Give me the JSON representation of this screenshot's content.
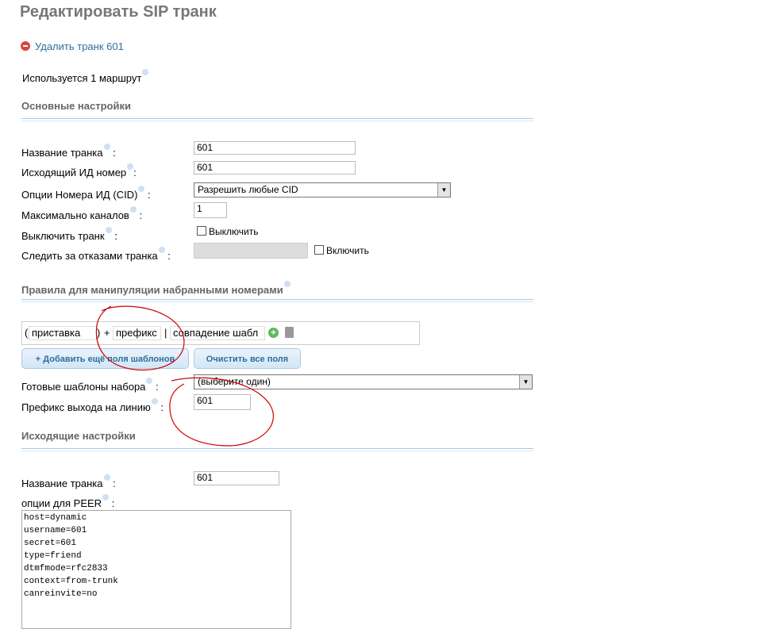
{
  "title": "Редактировать SIP транк",
  "delete_link": "Удалить транк 601",
  "used_routes": "Используется 1 маршрут",
  "sections": {
    "general": "Основные настройки",
    "dial_rules": "Правила для манипуляции набранными номерами",
    "outgoing": "Исходящие настройки"
  },
  "general": {
    "trunk_name_label": "Название транка",
    "trunk_name": "601",
    "outbound_cid_label": "Исходящий ИД номер",
    "outbound_cid": "601",
    "cid_options_label": "Опции Номера ИД (CID)",
    "cid_options": "Разрешить любые CID",
    "max_channels_label": "Максимально каналов",
    "max_channels": "1",
    "disable_label": "Выключить транк",
    "disable_checkbox": "Выключить",
    "monitor_label": "Следить за отказами транка",
    "monitor_checkbox": "Включить"
  },
  "dial_rules": {
    "prepend": "приставка",
    "plus": "+",
    "prefix": "префикс",
    "pipe": "|",
    "match": "совпадение шабл",
    "open_paren": "(",
    "close_paren": ")",
    "add_button": "+ Добавить ещё поля шаблонов",
    "clear_button": "Очистить все поля",
    "wizards_label": "Готовые шаблоны набора",
    "wizards_value": "(выберите один)",
    "outbound_prefix_label": "Префикс выхода на линию",
    "outbound_prefix": "601"
  },
  "outgoing": {
    "trunk_name_label": "Название транка",
    "trunk_name": "601",
    "peer_label": "опции для PEER",
    "peer_details": "host=dynamic\nusername=601\nsecret=601\ntype=friend\ndtmfmode=rfc2833\ncontext=from-trunk\ncanreinvite=no"
  },
  "colon": ":",
  "annotation_color": "#cc0000"
}
